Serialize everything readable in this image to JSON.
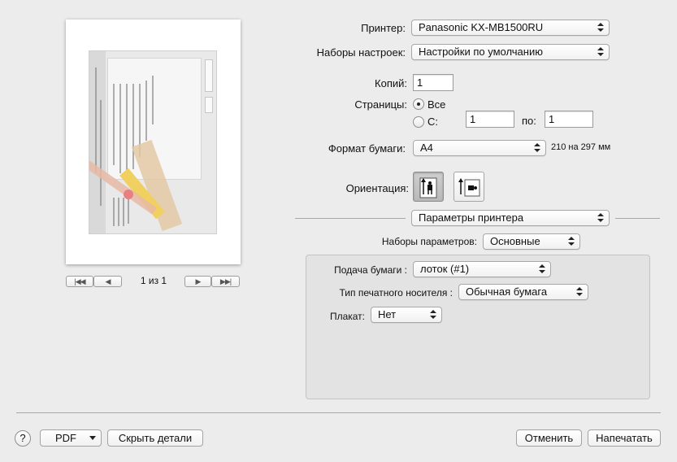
{
  "preview": {
    "page_indicator": "1 из 1",
    "nav_first": "|◀◀",
    "nav_prev": "◀",
    "nav_next": "▶",
    "nav_last": "▶▶|"
  },
  "printer": {
    "label": "Принтер:",
    "value": "Panasonic KX-MB1500RU"
  },
  "presets": {
    "label": "Наборы настроек:",
    "value": "Настройки по умолчанию"
  },
  "copies": {
    "label": "Копий:",
    "value": "1"
  },
  "pages": {
    "label": "Страницы:",
    "all_label": "Все",
    "from_label": "С:",
    "from_value": "1",
    "to_label": "по:",
    "to_value": "1"
  },
  "paper_size": {
    "label": "Формат бумаги:",
    "value": "A4",
    "dimensions": "210 на 297 мм"
  },
  "orientation": {
    "label": "Ориентация:"
  },
  "section_popup": {
    "value": "Параметры принтера"
  },
  "param_sets": {
    "label": "Наборы параметров:",
    "value": "Основные"
  },
  "panel": {
    "paper_feed": {
      "label": "Подача бумаги :",
      "value": "лоток (#1)"
    },
    "media_type": {
      "label": "Тип печатного носителя :",
      "value": "Обычная бумага"
    },
    "poster": {
      "label": "Плакат:",
      "value": "Нет"
    }
  },
  "footer": {
    "help": "?",
    "pdf": "PDF",
    "hide_details": "Скрыть детали",
    "cancel": "Отменить",
    "print": "Напечатать"
  }
}
